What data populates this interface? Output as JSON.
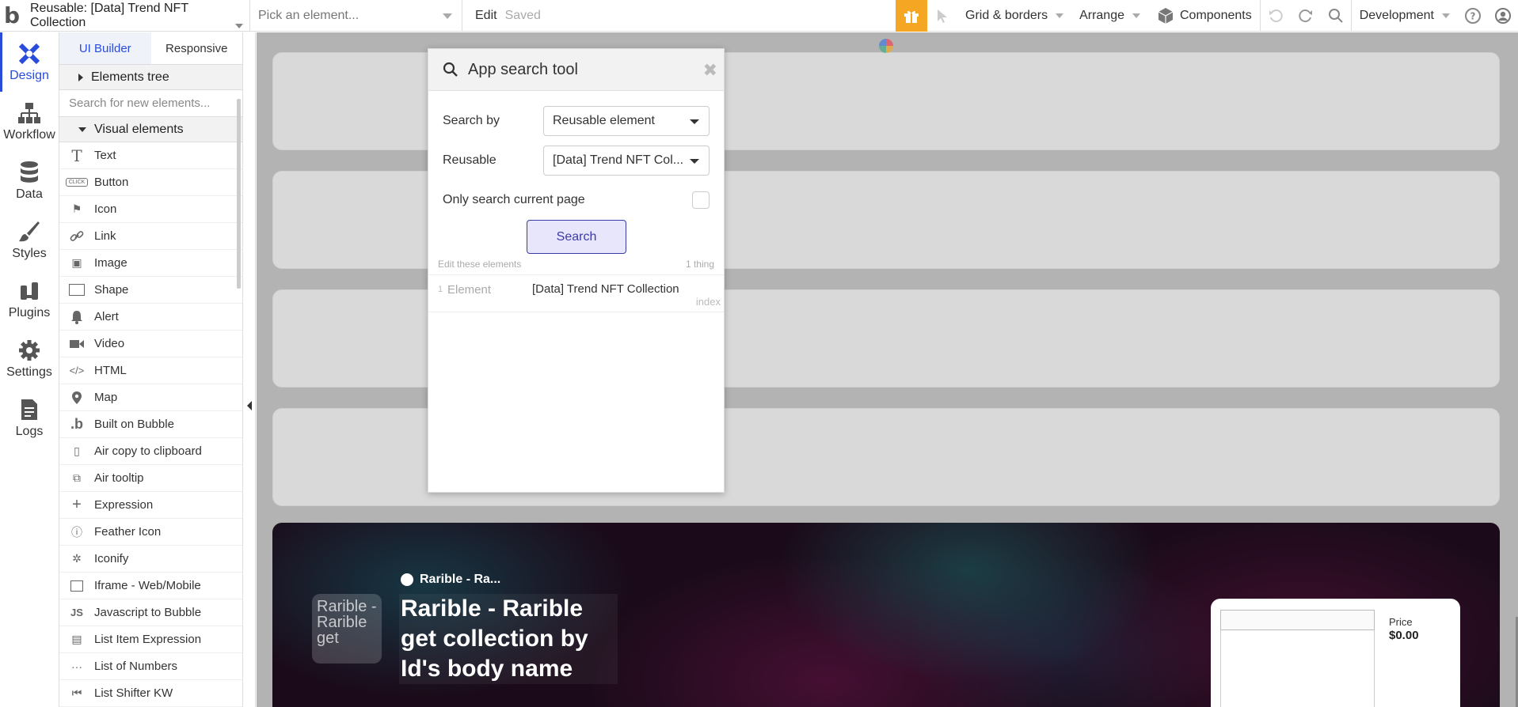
{
  "topbar": {
    "page_name": "Reusable: [Data] Trend NFT Collection",
    "pick_element_placeholder": "Pick an element...",
    "edit_label": "Edit",
    "saved_label": "Saved",
    "grid_borders_label": "Grid & borders",
    "arrange_label": "Arrange",
    "components_label": "Components",
    "development_label": "Development",
    "accent_color": "#f5a623"
  },
  "nav": {
    "items": [
      {
        "label": "Design",
        "icon": "design-icon"
      },
      {
        "label": "Workflow",
        "icon": "workflow-icon"
      },
      {
        "label": "Data",
        "icon": "database-icon"
      },
      {
        "label": "Styles",
        "icon": "brush-icon"
      },
      {
        "label": "Plugins",
        "icon": "plug-icon"
      },
      {
        "label": "Settings",
        "icon": "gear-icon"
      },
      {
        "label": "Logs",
        "icon": "document-icon"
      }
    ]
  },
  "panel": {
    "tabs": [
      "UI Builder",
      "Responsive"
    ],
    "elements_tree_label": "Elements tree",
    "search_placeholder": "Search for new elements...",
    "visual_elements_label": "Visual elements",
    "elements": [
      {
        "label": "Text",
        "icon": "T"
      },
      {
        "label": "Button",
        "icon": "CLICK"
      },
      {
        "label": "Icon",
        "icon": "⚑"
      },
      {
        "label": "Link",
        "icon": "🔗"
      },
      {
        "label": "Image",
        "icon": "▣"
      },
      {
        "label": "Shape",
        "icon": "▭"
      },
      {
        "label": "Alert",
        "icon": "🔔"
      },
      {
        "label": "Video",
        "icon": "▶"
      },
      {
        "label": "HTML",
        "icon": "</>"
      },
      {
        "label": "Map",
        "icon": "⚲"
      },
      {
        "label": "Built on Bubble",
        "icon": "b"
      },
      {
        "label": "Air copy to clipboard",
        "icon": "▯"
      },
      {
        "label": "Air tooltip",
        "icon": "⧉"
      },
      {
        "label": "Expression",
        "icon": "+"
      },
      {
        "label": "Feather Icon",
        "icon": "ⓘ"
      },
      {
        "label": "Iconify",
        "icon": "✲"
      },
      {
        "label": "Iframe - Web/Mobile",
        "icon": "▭"
      },
      {
        "label": "Javascript to Bubble",
        "icon": "JS"
      },
      {
        "label": "List Item Expression",
        "icon": "▤"
      },
      {
        "label": "List of Numbers",
        "icon": "···"
      },
      {
        "label": "List Shifter KW",
        "icon": "⏮"
      }
    ]
  },
  "search_tool": {
    "title": "App search tool",
    "search_by_label": "Search by",
    "search_by_value": "Reusable element",
    "reusable_label": "Reusable",
    "reusable_value": "[Data] Trend NFT Col...",
    "only_current_page_label": "Only search current page",
    "search_button": "Search",
    "edit_these_label": "Edit these elements",
    "count_label": "1 thing",
    "results": [
      {
        "num": "1",
        "type": "Element",
        "name": "[Data] Trend NFT Collection",
        "index_label": "index"
      }
    ],
    "button_color": "#3b3ba8"
  },
  "hero": {
    "thumb_text": "Rarible - Rarible get",
    "creator": "Rarible - Ra...",
    "title": "Rarible - Rarible get collection by Id's body name",
    "price_label": "Price",
    "price_value": "$0.00"
  }
}
